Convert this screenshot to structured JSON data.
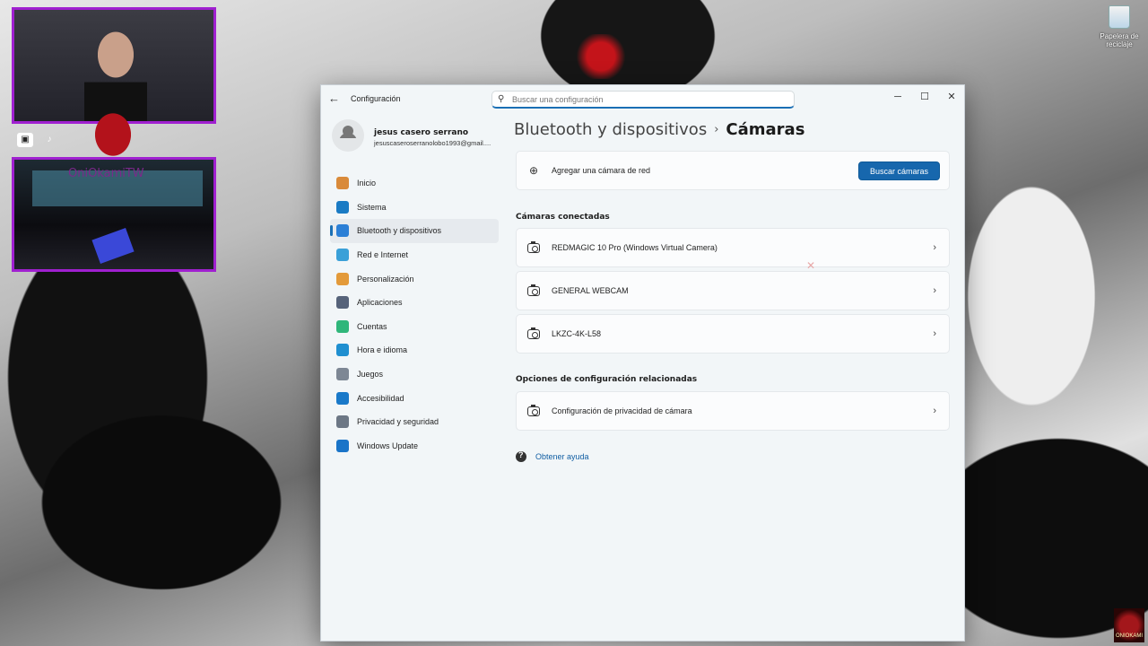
{
  "window": {
    "title": "Configuración",
    "search_placeholder": "Buscar una configuración",
    "back_symbol": "←",
    "controls": {
      "minimize": "─",
      "maximize": "☐",
      "close": "✕"
    }
  },
  "profile": {
    "name": "jesus casero serrano",
    "email": "jesuscaseroserranolobo1993@gmail...."
  },
  "nav": {
    "items": [
      {
        "label": "Inicio",
        "icon": "home-icon",
        "color": "#d98a3a"
      },
      {
        "label": "Sistema",
        "icon": "system-icon",
        "color": "#1a7bc4"
      },
      {
        "label": "Bluetooth y dispositivos",
        "icon": "bluetooth-icon",
        "color": "#2b7fd6",
        "active": true
      },
      {
        "label": "Red e Internet",
        "icon": "wifi-icon",
        "color": "#3aa0d8"
      },
      {
        "label": "Personalización",
        "icon": "brush-icon",
        "color": "#e39a3a"
      },
      {
        "label": "Aplicaciones",
        "icon": "apps-icon",
        "color": "#56637a"
      },
      {
        "label": "Cuentas",
        "icon": "accounts-icon",
        "color": "#2fb67a"
      },
      {
        "label": "Hora e idioma",
        "icon": "globe-clock-icon",
        "color": "#1f8fd0"
      },
      {
        "label": "Juegos",
        "icon": "gamepad-icon",
        "color": "#7d8794"
      },
      {
        "label": "Accesibilidad",
        "icon": "accessibility-icon",
        "color": "#1979c9"
      },
      {
        "label": "Privacidad y seguridad",
        "icon": "shield-icon",
        "color": "#6c7785"
      },
      {
        "label": "Windows Update",
        "icon": "update-icon",
        "color": "#1a74c8"
      }
    ]
  },
  "content": {
    "breadcrumb_parent": "Bluetooth y dispositivos",
    "breadcrumb_sep": "›",
    "breadcrumb_current": "Cámaras",
    "add_network_camera_label": "Agregar una cámara de red",
    "search_cameras_button": "Buscar cámaras",
    "connected_title": "Cámaras conectadas",
    "cameras": [
      "REDMAGIC 10 Pro (Windows Virtual Camera)",
      "GENERAL WEBCAM",
      "LKZC-4K-L58"
    ],
    "related_title": "Opciones de configuración relacionadas",
    "privacy_label": "Configuración de privacidad de cámara",
    "help_link": "Obtener ayuda",
    "chevron": "›",
    "plus_symbol": "⊕"
  },
  "desktop": {
    "recycle_bin_label": "Papelera de reciclaje",
    "stream_name": "OniOkamiTW",
    "brand_corner": "ONIOKAMI",
    "social_icons": [
      "twitch-icon",
      "tiktok-icon",
      "youtube-icon"
    ]
  },
  "colors": {
    "accent": "#1767ad",
    "overlay_border": "#a020d0",
    "link": "#115ea3"
  }
}
